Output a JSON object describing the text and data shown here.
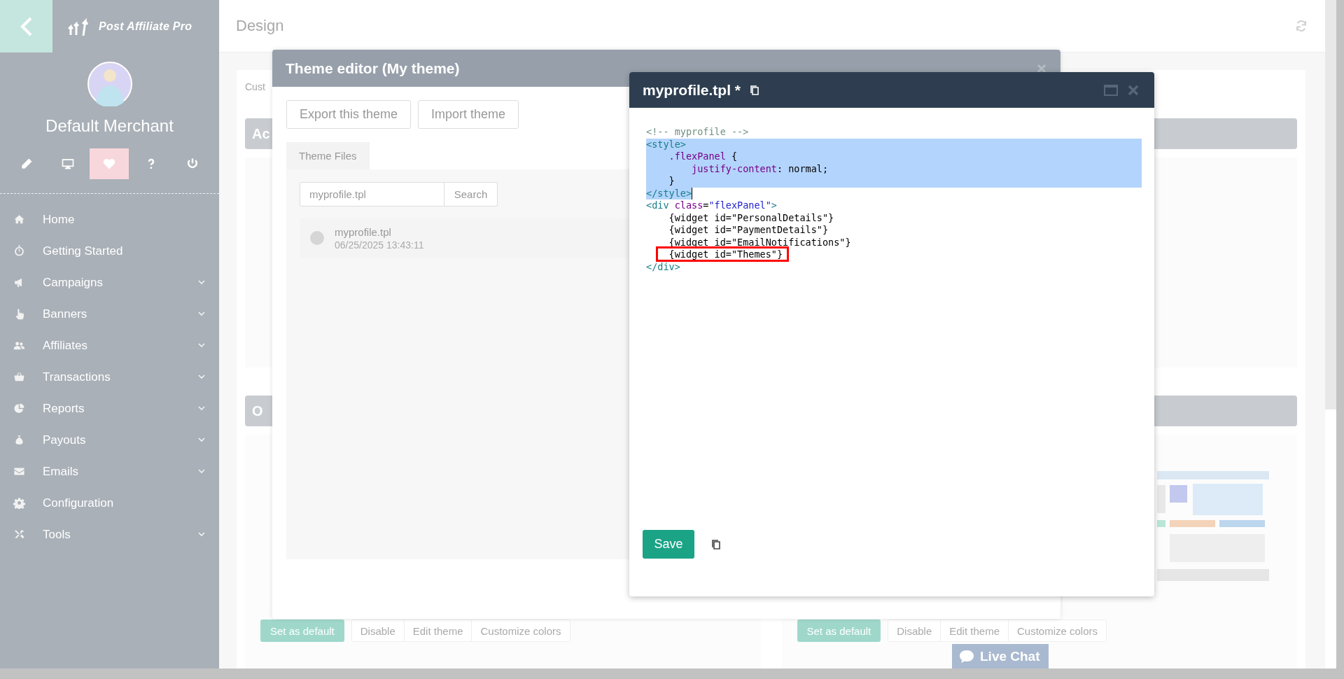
{
  "sidebar": {
    "brand": "Post Affiliate Pro",
    "user": "Default Merchant",
    "quick_actions": [
      {
        "selected": false
      },
      {
        "selected": false
      },
      {
        "selected": true
      },
      {
        "selected": false
      },
      {
        "selected": false
      }
    ],
    "menu": [
      {
        "label": "Home",
        "expandable": false
      },
      {
        "label": "Getting Started",
        "expandable": false
      },
      {
        "label": "Campaigns",
        "expandable": true
      },
      {
        "label": "Banners",
        "expandable": true
      },
      {
        "label": "Affiliates",
        "expandable": true
      },
      {
        "label": "Transactions",
        "expandable": true
      },
      {
        "label": "Reports",
        "expandable": true
      },
      {
        "label": "Payouts",
        "expandable": true
      },
      {
        "label": "Emails",
        "expandable": true
      },
      {
        "label": "Configuration",
        "expandable": false
      },
      {
        "label": "Tools",
        "expandable": true
      }
    ]
  },
  "page": {
    "title": "Design",
    "tab": "Cust",
    "section_headers": [
      "Ac",
      "O"
    ],
    "theme_cards": [
      {
        "buttons": [
          "Set as default",
          "Disable",
          "Edit theme",
          "Customize colors"
        ]
      },
      {
        "preview": true,
        "buttons": [
          "Set as default",
          "Disable",
          "Edit theme",
          "Customize colors"
        ]
      }
    ]
  },
  "theme_editor": {
    "title": "Theme editor (My theme)",
    "buttons": [
      "Export this theme",
      "Import theme"
    ],
    "tab": "Theme Files",
    "search": {
      "value": "myprofile.tpl",
      "button": "Search"
    },
    "files": [
      {
        "name": "myprofile.tpl",
        "date": "06/25/2025 13:43:11",
        "selected": false
      }
    ]
  },
  "code_editor": {
    "title": "myprofile.tpl *",
    "save": "Save",
    "lines": [
      {
        "selected": false,
        "tokens": [
          {
            "kind": "comment",
            "text": "<!-- myprofile -->"
          }
        ]
      },
      {
        "selected": true,
        "full_width": true,
        "tokens": [
          {
            "kind": "tag",
            "text": "<style>"
          }
        ]
      },
      {
        "selected": true,
        "full_width": true,
        "tokens": [
          {
            "kind": "prop",
            "text": "    .flexPanel"
          },
          {
            "kind": "text",
            "text": " {"
          }
        ]
      },
      {
        "selected": true,
        "full_width": true,
        "tokens": [
          {
            "kind": "prop",
            "text": "        justify-content"
          },
          {
            "kind": "text",
            "text": ": normal;"
          }
        ]
      },
      {
        "selected": true,
        "full_width": true,
        "tokens": [
          {
            "kind": "text",
            "text": "    }"
          }
        ]
      },
      {
        "selected": true,
        "full_width": false,
        "cursor": true,
        "tokens": [
          {
            "kind": "tag",
            "text": "</style>"
          }
        ]
      },
      {
        "selected": false,
        "tokens": [
          {
            "kind": "tag",
            "text": "<div"
          },
          {
            "kind": "attr",
            "text": " class"
          },
          {
            "kind": "text",
            "text": "="
          },
          {
            "kind": "string",
            "text": "\"flexPanel\""
          },
          {
            "kind": "tag",
            "text": ">"
          }
        ]
      },
      {
        "selected": false,
        "tokens": [
          {
            "kind": "text",
            "text": "    {widget id=\"PersonalDetails\"}"
          }
        ]
      },
      {
        "selected": false,
        "tokens": [
          {
            "kind": "text",
            "text": "    {widget id=\"PaymentDetails\"}"
          }
        ]
      },
      {
        "selected": false,
        "tokens": [
          {
            "kind": "text",
            "text": "    {widget id=\"EmailNotifications\"}"
          }
        ]
      },
      {
        "selected": false,
        "boxed": true,
        "tokens": [
          {
            "kind": "text",
            "text": "    {widget id=\"Themes\"}"
          }
        ]
      },
      {
        "selected": false,
        "tokens": [
          {
            "kind": "tag",
            "text": "</div>"
          }
        ]
      }
    ]
  },
  "live_chat": "Live Chat"
}
